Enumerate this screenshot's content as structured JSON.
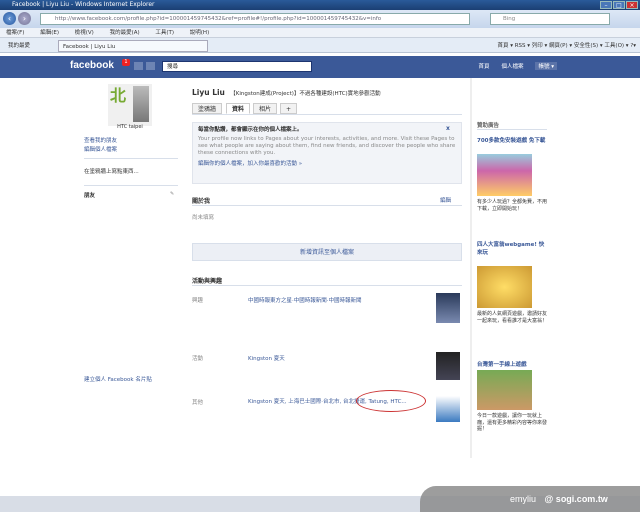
{
  "window": {
    "title": "Facebook | Liyu Liu - Windows Internet Explorer"
  },
  "addressbar": {
    "url": "http://www.facebook.com/profile.php?id=100001459745432&ref=profile#!/profile.php?id=100001459745432&v=info",
    "search_placeholder": "Bing"
  },
  "menubar": {
    "items": [
      "檔案(F)",
      "編輯(E)",
      "檢視(V)",
      "我的最愛(A)",
      "工具(T)",
      "說明(H)"
    ]
  },
  "tabs": {
    "favorites": "我的最愛",
    "active_tab": "Facebook | Liyu Liu",
    "tools": "首頁 ▾  RSS ▾  列印 ▾  網頁(P) ▾  安全性(S) ▾  工具(O) ▾  ?▾"
  },
  "fb": {
    "logo": "facebook",
    "notif_count": "1",
    "search_value": "搜尋",
    "nav": [
      "首頁",
      "個人檔案",
      "帳號 ▾"
    ],
    "profile_name": "Liyu Liu",
    "profile_tagline": "【Kingston建成(Project)】不過各種建設(HTC)實地參觀活動",
    "profile_pic_char": "北",
    "profile_brand": "HTC taipei",
    "sidebar": [
      "查看我的朋友",
      "編輯個人檔案",
      "在塗鴉牆上寫點東西...",
      "朋友"
    ],
    "page_tabs": [
      "塗鴉牆",
      "資料",
      "相片",
      "+"
    ],
    "notice_title": "每當你點讚，都會顯示在你的個人檔案上。",
    "notice_body": "Your profile now links to Pages about your interests, activities, and more. Visit these Pages to see what people are saying about them, find new friends, and discover the people who share these connections with you.",
    "notice_link": "編輯你的個人檔案，加入你最喜歡的活動 »",
    "section_basic": "關於我",
    "section_edit": "編輯",
    "section_empty": "尚未填寫",
    "add_info_button": "新增資訊至個人檔案",
    "section_likes": "活動與興趣",
    "likes_rows": [
      {
        "label": "興趣",
        "text": "中國時報東方之星‧中國時報新聞‧中國時報新聞"
      },
      {
        "label": "活動",
        "text": "Kingston 夏天"
      },
      {
        "label": "其他",
        "text": "Kingston 夏天, 上海巴士國際‧台北市, 台北捷運, Tatung, HTC..."
      }
    ],
    "sidebar_bottom": "建立個人 Facebook 名片貼",
    "ads_header": "贊助廣告",
    "ads": [
      {
        "title": "700多款免安裝遊戲 免下載",
        "text": "有多少人玩過？全都免費，不用下載，立即開始玩！"
      },
      {
        "title": "四人大富翁webgame! 快來玩",
        "text": "最新的人氣網頁遊戲，邀請好友一起來玩，看看誰才是大富翁！"
      },
      {
        "title": "台灣第一手線上遊戲",
        "text": "今日一款遊戲，讓你一玩就上癮，還有更多精彩內容等你來發掘！"
      }
    ]
  },
  "watermark": {
    "user": "emyliu",
    "site": "@ sogi.com.tw"
  },
  "colors": {
    "fb_blue": "#3b5998",
    "fb_bar": "#3b5998",
    "link": "#3b5998"
  }
}
